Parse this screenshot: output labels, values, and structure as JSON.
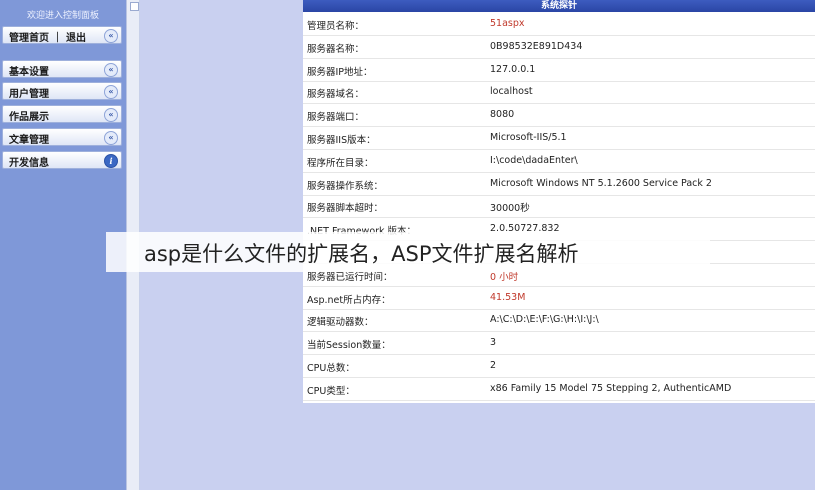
{
  "sidebar": {
    "title": "欢迎进入控制面板",
    "items": [
      {
        "label": "管理首页 ｜ 退出",
        "icon": "collapse-icon",
        "glyph": "«"
      },
      {
        "label": "基本设置",
        "icon": "collapse-icon",
        "glyph": "«"
      },
      {
        "label": "用户管理",
        "icon": "collapse-icon",
        "glyph": "«"
      },
      {
        "label": "作品展示",
        "icon": "collapse-icon",
        "glyph": "«"
      },
      {
        "label": "文章管理",
        "icon": "collapse-icon",
        "glyph": "«"
      },
      {
        "label": "开发信息",
        "icon": "info-icon",
        "glyph": "i"
      }
    ]
  },
  "panel": {
    "header": "系统探针",
    "rows": [
      {
        "label": "管理员名称：",
        "value": "51aspx",
        "accent": "red"
      },
      {
        "label": "服务器名称：",
        "value": "0B98532E891D434"
      },
      {
        "label": "服务器IP地址：",
        "value": "127.0.0.1"
      },
      {
        "label": "服务器域名：",
        "value": "localhost"
      },
      {
        "label": "服务器端口：",
        "value": "8080"
      },
      {
        "label": "服务器IIS版本：",
        "value": "Microsoft-IIS/5.1"
      },
      {
        "label": "程序所在目录：",
        "value": "I:\\code\\dadaEnter\\"
      },
      {
        "label": "服务器操作系统：",
        "value": "Microsoft Windows NT 5.1.2600 Service Pack 2"
      },
      {
        "label": "服务器脚本超时：",
        "value": "30000秒"
      },
      {
        "label": ".NET Framework 版本：",
        "value": "2.0.50727.832"
      },
      {
        "label": "",
        "value": ""
      },
      {
        "label": "服务器已运行时间：",
        "value": "0 小时",
        "accent": "red"
      },
      {
        "label": "Asp.net所占内存：",
        "value": "41.53M",
        "accent": "red"
      },
      {
        "label": "逻辑驱动器数：",
        "value": "A:\\C:\\D:\\E:\\F:\\G:\\H:\\I:\\J:\\"
      },
      {
        "label": "当前Session数量：",
        "value": "3"
      },
      {
        "label": "CPU总数：",
        "value": "2"
      },
      {
        "label": "CPU类型：",
        "value": "x86 Family 15 Model 75 Stepping 2, AuthenticAMD"
      }
    ]
  },
  "caption": "asp是什么文件的扩展名，ASP文件扩展名解析",
  "colors": {
    "accent_blue": "#2a45a5",
    "sidebar": "#7f98d8",
    "value_red": "#c0392b"
  }
}
